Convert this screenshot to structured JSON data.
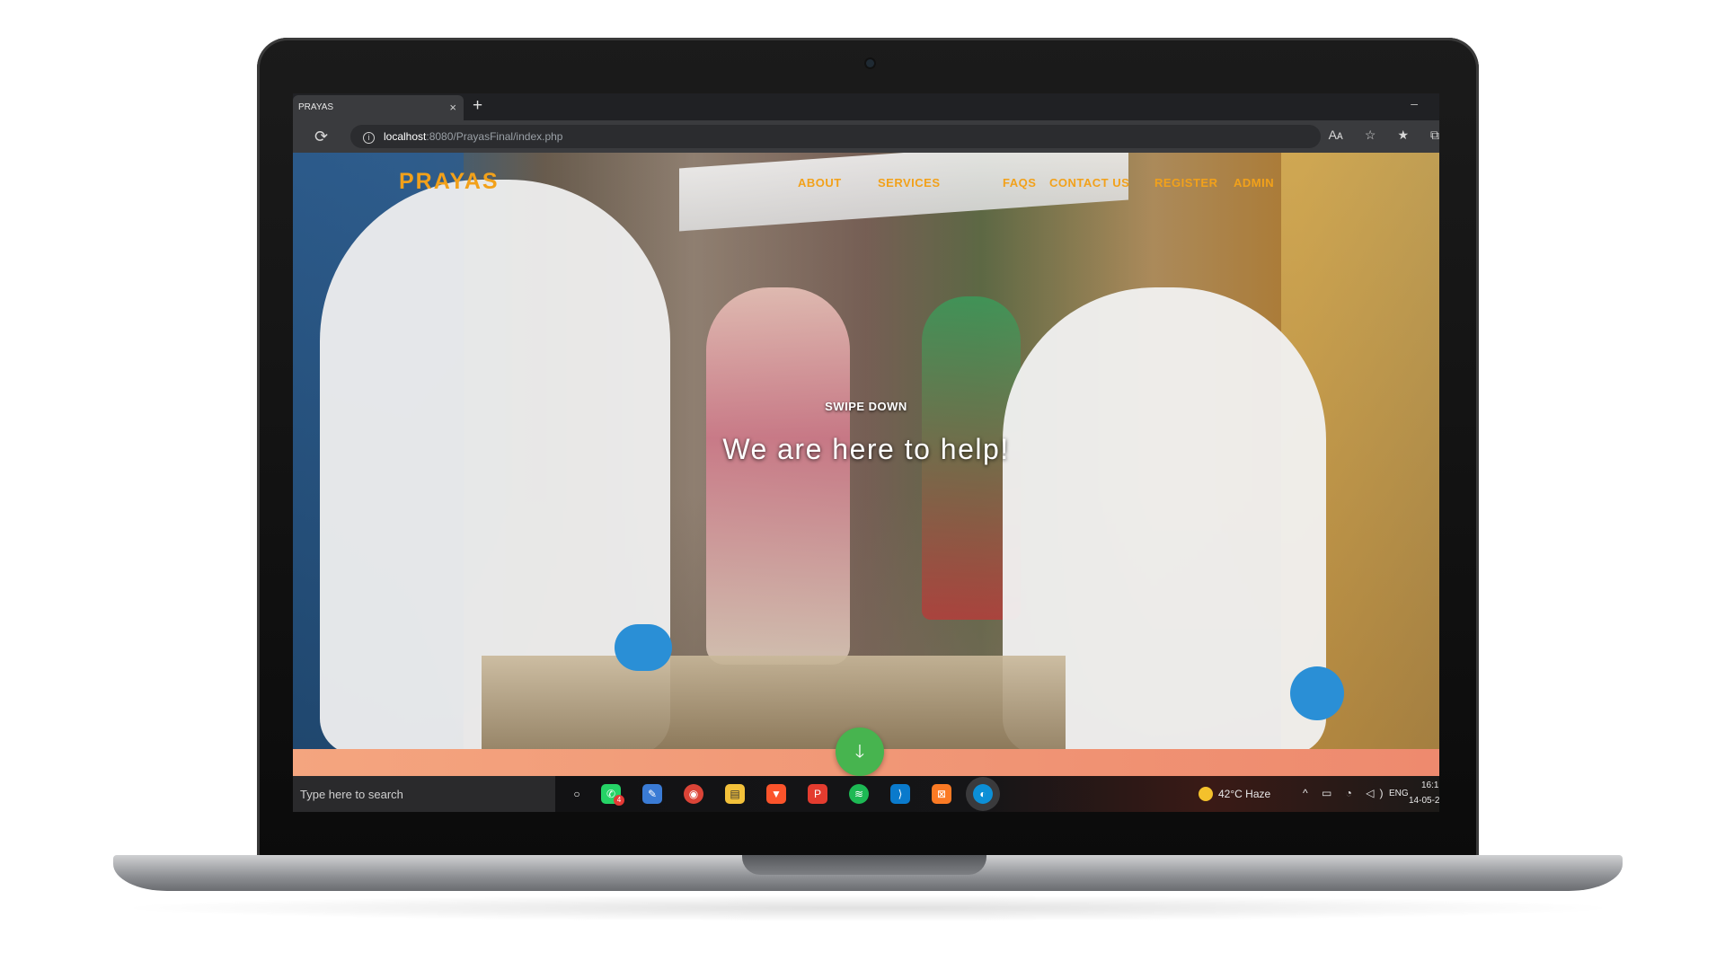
{
  "browser": {
    "tab_title": "PRAYAS",
    "tab_close": "×",
    "new_tab": "+",
    "minimize": "–",
    "url_host": "localhost",
    "url_rest": ":8080/PrayasFinal/index.php",
    "reload_icon": "⟳",
    "info_icon": "i",
    "toolbar_icons": [
      "read-aloud-icon",
      "add-favorite-icon",
      "favorites-icon",
      "collections-icon"
    ],
    "toolbar_glyphs": [
      "Aᴀ",
      "☆",
      "★",
      "⧉"
    ]
  },
  "site": {
    "brand": "PRAYAS",
    "brand_color": "#f2a11a",
    "nav": {
      "about": "ABOUT",
      "services": "SERVICES",
      "faqs": "FAQS",
      "contact": "CONTACT US",
      "register": "REGISTER",
      "admin": "ADMIN"
    },
    "hero": {
      "swipe_label": "SWIPE DOWN",
      "heading": "We are here to help!",
      "scroll_icon": "🡓"
    },
    "scroll_button_color": "#47b44f"
  },
  "taskbar": {
    "search_placeholder": "Type here to search",
    "apps": [
      {
        "name": "cortana-icon",
        "glyph": "○",
        "color": "transparent"
      },
      {
        "name": "whatsapp-icon",
        "glyph": "✆",
        "color": "#25d366"
      },
      {
        "name": "pen-app-icon",
        "glyph": "✎",
        "color": "#3a7bd5"
      },
      {
        "name": "chrome-icon",
        "glyph": "◉",
        "color": "#db4437"
      },
      {
        "name": "file-explorer-icon",
        "glyph": "▤",
        "color": "#f3c13a"
      },
      {
        "name": "brave-icon",
        "glyph": "▼",
        "color": "#fb542b"
      },
      {
        "name": "p-app-icon",
        "glyph": "P",
        "color": "#e43c2f"
      },
      {
        "name": "spotify-icon",
        "glyph": "≋",
        "color": "#1db954"
      },
      {
        "name": "vscode-icon",
        "glyph": "⟩",
        "color": "#0a7acc"
      },
      {
        "name": "xampp-icon",
        "glyph": "⊠",
        "color": "#fb7a24"
      },
      {
        "name": "edge-icon",
        "glyph": "◐",
        "color": "#0c8fd6"
      }
    ],
    "whatsapp_badge": "4",
    "weather": "42°C  Haze",
    "tray": "^ ▭ ◔ ◁)",
    "language": "ENG",
    "time": "16:1",
    "date": "14-05-2"
  }
}
